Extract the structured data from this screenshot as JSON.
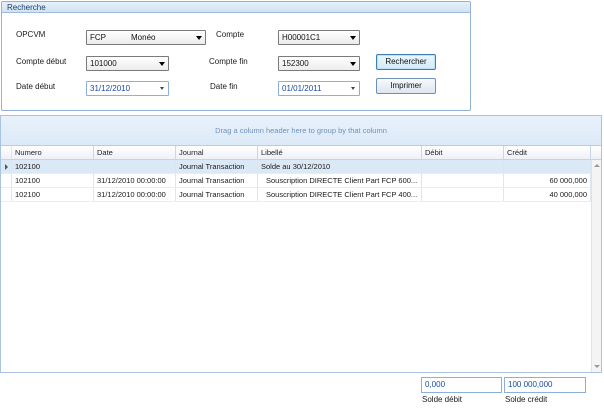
{
  "search": {
    "title": "Recherche",
    "opcvm": {
      "label": "OPCVM",
      "code": "FCP",
      "name": "Monéo"
    },
    "compte": {
      "label": "Compte",
      "value": "H00001C1"
    },
    "compte_debut": {
      "label": "Compte début",
      "value": "101000"
    },
    "compte_fin": {
      "label": "Compte fin",
      "value": "152300"
    },
    "date_debut": {
      "label": "Date début",
      "value": "31/12/2010"
    },
    "date_fin": {
      "label": "Date fin",
      "value": "01/01/2011"
    },
    "rechercher_label": "Rechercher",
    "imprimer_label": "Imprimer"
  },
  "grid": {
    "group_hint": "Drag a column header here to group by that column",
    "columns": [
      "Numero",
      "Date",
      "Journal",
      "Libellé",
      "Débit",
      "Crédit"
    ],
    "rows": [
      {
        "numero": "102100",
        "date": "",
        "journal": "Journal Transaction",
        "libelle": "Solde au 30/12/2010",
        "debit": "",
        "credit": ""
      },
      {
        "numero": "102100",
        "date": "31/12/2010 00:00:00",
        "journal": "Journal Transaction",
        "libelle": "Souscription DIRECTE Client Part FCP 600...",
        "debit": "",
        "credit": "60 000,000"
      },
      {
        "numero": "102100",
        "date": "31/12/2010 00:00:00",
        "journal": "Journal Transaction",
        "libelle": "Souscription DIRECTE Client Part FCP 400...",
        "debit": "",
        "credit": "40 000,000"
      }
    ]
  },
  "totals": {
    "solde_debit_value": "0,000",
    "solde_debit_label": "Solde débit",
    "solde_credit_value": "100 000,000",
    "solde_credit_label": "Solde crédit"
  },
  "colors": {
    "accent": "#8fb2d6",
    "selected_row": "#dbe9f7",
    "date_text": "#1a4aa0"
  },
  "icons": {
    "row_indicator": "triangle-right-icon",
    "dropdown": "chevron-down-icon"
  }
}
